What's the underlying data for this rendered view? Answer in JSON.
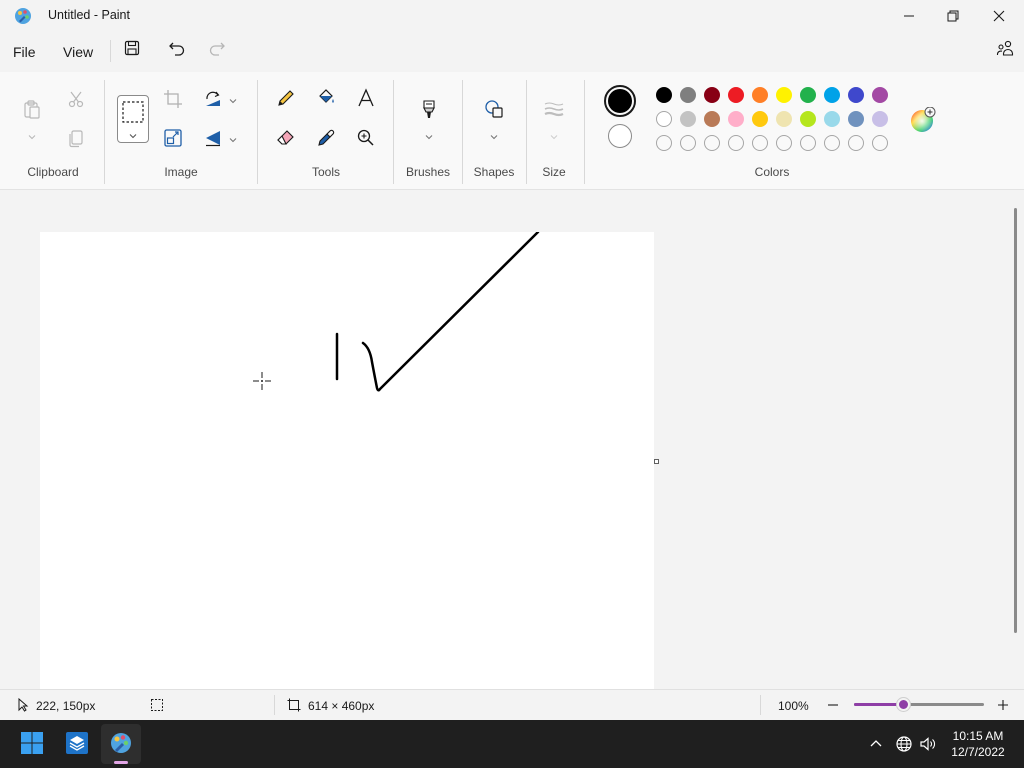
{
  "window": {
    "title": "Untitled - Paint"
  },
  "menu": {
    "file": "File",
    "view": "View"
  },
  "ribbon": {
    "groups": {
      "clipboard": "Clipboard",
      "image": "Image",
      "tools": "Tools",
      "brushes": "Brushes",
      "shapes": "Shapes",
      "size": "Size",
      "colors": "Colors"
    }
  },
  "colors": {
    "primary": "#000000",
    "secondary": "#ffffff",
    "palette_row1": [
      "#000000",
      "#7f7f7f",
      "#880015",
      "#ed1c24",
      "#ff7f27",
      "#fff200",
      "#22b14c",
      "#00a2e8",
      "#3f48cc",
      "#a349a4"
    ],
    "palette_row2": [
      "#ffffff",
      "#c3c3c3",
      "#b97a57",
      "#ffaec9",
      "#ffc90e",
      "#efe4b0",
      "#b5e61d",
      "#99d9ea",
      "#7092be",
      "#c8bfe7"
    ],
    "palette_row3_empty_count": 10
  },
  "status": {
    "cursor_position": "222, 150px",
    "canvas_size": "614 × 460px",
    "zoom": "100%",
    "zoom_level": 1.0
  },
  "taskbar": {
    "time": "10:15 AM",
    "date": "12/7/2022"
  }
}
